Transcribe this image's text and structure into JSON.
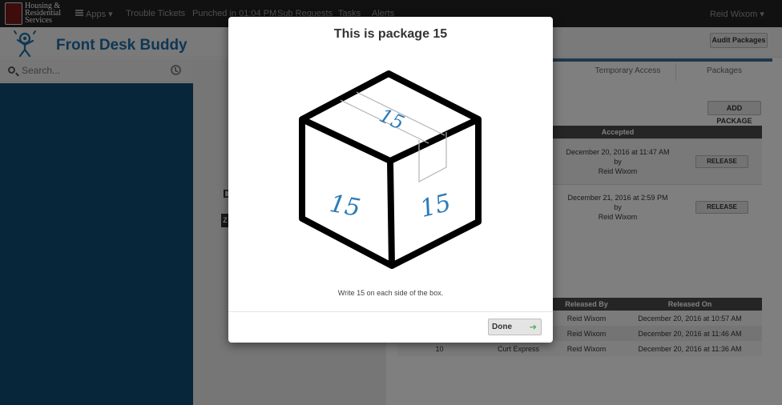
{
  "topnav": {
    "logo_text": [
      "Housing &",
      "Residential",
      "Services"
    ],
    "links": {
      "apps": "Apps",
      "trouble": "Trouble Tickets",
      "punched": "Punched in 01:04 PM",
      "sub": "Sub Requests",
      "tasks": "Tasks",
      "alerts": "Alerts"
    },
    "user": "Reid Wixom",
    "caret": "▾"
  },
  "header": {
    "title": "Front Desk Buddy",
    "audit_button": "Audit Packages"
  },
  "search": {
    "placeholder": "Search..."
  },
  "main": {
    "tabs": [
      "Temporary Access",
      "Packages"
    ],
    "add_package": "ADD PACKAGE",
    "partial_heading": "D",
    "partial_badge": "Z",
    "packages_table": {
      "headers": [
        "Accepted",
        ""
      ],
      "rows": [
        {
          "accepted": [
            "December 20, 2016 at 11:47 AM",
            "by",
            "Reid Wixom"
          ],
          "action": "RELEASE"
        },
        {
          "accepted": [
            "December 21, 2016 at 2:59 PM",
            "by",
            "Reid Wixom"
          ],
          "action": "RELEASE"
        }
      ]
    },
    "history_table": {
      "headers": [
        "",
        "",
        "Released By",
        "Released On"
      ],
      "rows": [
        [
          "",
          "",
          "Reid Wixom",
          "December 20, 2016 at 10:57 AM"
        ],
        [
          "",
          "",
          "Reid Wixom",
          "December 20, 2016 at 11:46 AM"
        ],
        [
          "10",
          "Curt Express",
          "Reid Wixom",
          "December 20, 2016 at 11:36 AM"
        ]
      ]
    }
  },
  "modal": {
    "title": "This is package 15",
    "box_number": "15",
    "instruction": "Write 15 on each side of the box.",
    "done_label": "Done",
    "done_icon": "arrow-right-icon"
  },
  "colors": {
    "topnav": "#222222",
    "sidebar": "#0f4c73",
    "brand_blue": "#1f6fa6",
    "done_arrow": "#4caf50"
  }
}
